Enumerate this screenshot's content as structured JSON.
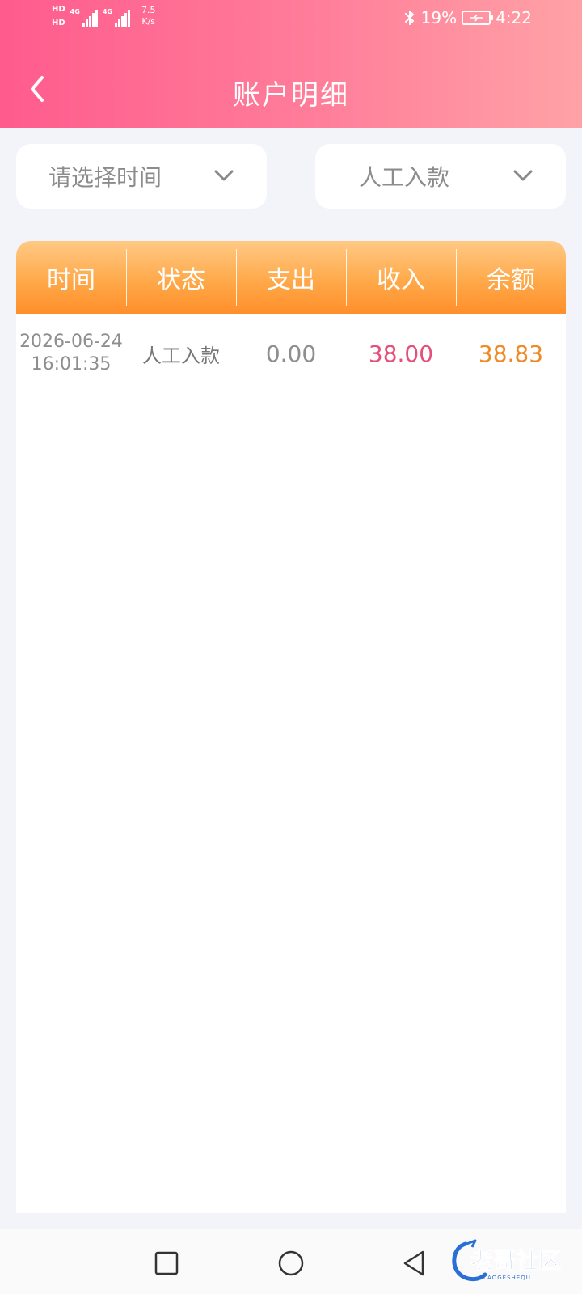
{
  "status_bar": {
    "sim1": "HD",
    "sim2": "HD",
    "net1": "4G",
    "net2": "4G",
    "speed_value": "7.5",
    "speed_unit": "K/s",
    "battery_percent": "19%",
    "time": "4:22"
  },
  "header": {
    "title": "账户明细"
  },
  "filters": {
    "time_placeholder": "请选择时间",
    "type_selected": "人工入款"
  },
  "table": {
    "columns": [
      "时间",
      "状态",
      "支出",
      "收入",
      "余额"
    ],
    "rows": [
      {
        "date": "2026-06-24",
        "time": "16:01:35",
        "status": "人工入款",
        "expense": "0.00",
        "income": "38.00",
        "balance": "38.83"
      }
    ]
  },
  "watermark": {
    "text": "老哥社区",
    "subtext": "LAOGESHEQU"
  },
  "colors": {
    "header_gradient_start": "#ff5b8d",
    "header_gradient_end": "#ffa2a6",
    "table_header_start": "#ffc985",
    "table_header_end": "#ff8f2a",
    "income": "#e4507c",
    "balance": "#f08a24"
  }
}
